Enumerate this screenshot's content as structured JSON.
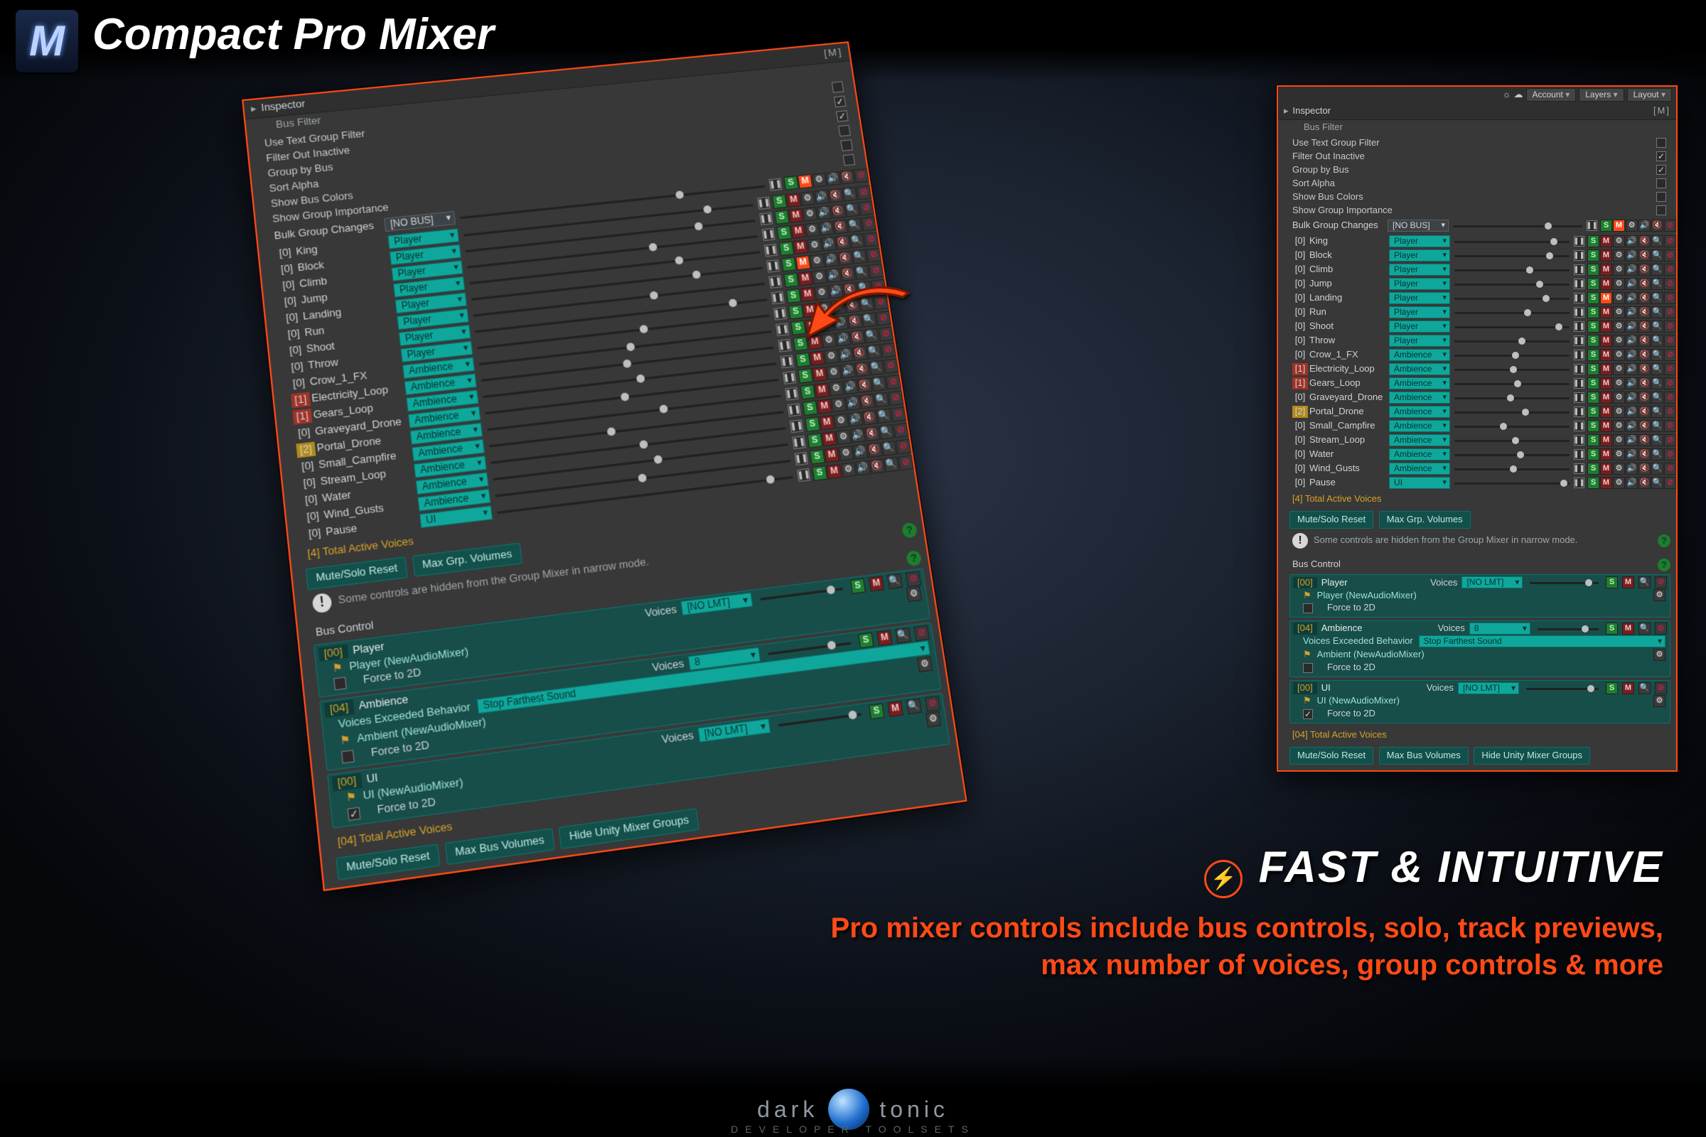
{
  "promo": {
    "title": "Compact Pro Mixer",
    "headline": "FAST & INTUITIVE",
    "subtitle": "Pro mixer controls include bus controls, solo, track previews, max number of voices, group controls & more",
    "brand_left": "dark",
    "brand_right": "tonic",
    "brand_tag": "DEVELOPER   TOOLSETS",
    "logo_letter": "M",
    "bolt": "⚡"
  },
  "inspector": {
    "header": "Inspector",
    "sub": "Bus Filter",
    "corner": "[M]",
    "options": [
      {
        "label": "Use Text Group Filter",
        "checked": false
      },
      {
        "label": "Filter Out Inactive",
        "checked": true
      },
      {
        "label": "Group by Bus",
        "checked": true
      },
      {
        "label": "Sort Alpha",
        "checked": false
      },
      {
        "label": "Show Bus Colors",
        "checked": false
      },
      {
        "label": "Show Group Importance",
        "checked": false
      }
    ],
    "bulk_label": "Bulk Group Changes",
    "bulk_bus": "[NO BUS]",
    "groups": [
      {
        "cnt": "[0]",
        "name": "King",
        "bus": "Player",
        "vol": 0.82
      },
      {
        "cnt": "[0]",
        "name": "Block",
        "bus": "Player",
        "vol": 0.78
      },
      {
        "cnt": "[0]",
        "name": "Climb",
        "bus": "Player",
        "vol": 0.62
      },
      {
        "cnt": "[0]",
        "name": "Jump",
        "bus": "Player",
        "vol": 0.7
      },
      {
        "cnt": "[0]",
        "name": "Landing",
        "bus": "Player",
        "vol": 0.75,
        "alert": true
      },
      {
        "cnt": "[0]",
        "name": "Run",
        "bus": "Player",
        "vol": 0.6
      },
      {
        "cnt": "[0]",
        "name": "Shoot",
        "bus": "Player",
        "vol": 0.86
      },
      {
        "cnt": "[0]",
        "name": "Throw",
        "bus": "Player",
        "vol": 0.55
      },
      {
        "cnt": "[0]",
        "name": "Crow_1_FX",
        "bus": "Ambience",
        "vol": 0.5
      },
      {
        "cnt": "[1]",
        "status": "bad",
        "name": "Electricity_Loop",
        "bus": "Ambience",
        "vol": 0.48
      },
      {
        "cnt": "[1]",
        "status": "bad",
        "name": "Gears_Loop",
        "bus": "Ambience",
        "vol": 0.52
      },
      {
        "cnt": "[0]",
        "name": "Graveyard_Drone",
        "bus": "Ambience",
        "vol": 0.46
      },
      {
        "cnt": "[2]",
        "status": "warn",
        "name": "Portal_Drone",
        "bus": "Ambience",
        "vol": 0.58
      },
      {
        "cnt": "[0]",
        "name": "Small_Campfire",
        "bus": "Ambience",
        "vol": 0.4
      },
      {
        "cnt": "[0]",
        "name": "Stream_Loop",
        "bus": "Ambience",
        "vol": 0.5
      },
      {
        "cnt": "[0]",
        "name": "Water",
        "bus": "Ambience",
        "vol": 0.54
      },
      {
        "cnt": "[0]",
        "name": "Wind_Gusts",
        "bus": "Ambience",
        "vol": 0.48
      },
      {
        "cnt": "[0]",
        "name": "Pause",
        "bus": "UI",
        "vol": 0.9
      }
    ],
    "total_active": "[4] Total Active Voices",
    "mute_reset": "Mute/Solo Reset",
    "max_grp": "Max Grp. Volumes",
    "notice": "Some controls are hidden from the Group Mixer in narrow mode.",
    "bus_section": "Bus Control",
    "voices_label": "Voices",
    "no_limit": "[NO LMT]",
    "buses": [
      {
        "cnt": "[00]",
        "name": "Player",
        "mixer": "Player (NewAudioMixer)",
        "force2d": false,
        "voices": "[NO LMT]",
        "vol": 0.78
      },
      {
        "cnt": "[04]",
        "name": "Ambience",
        "mixer": "Ambient (NewAudioMixer)",
        "force2d": false,
        "voices": "8",
        "vol": 0.7,
        "veb_label": "Voices Exceeded Behavior",
        "veb_value": "Stop Farthest Sound"
      },
      {
        "cnt": "[00]",
        "name": "UI",
        "mixer": "UI (NewAudioMixer)",
        "force2d": true,
        "voices": "[NO LMT]",
        "vol": 0.82
      }
    ],
    "bus_total": "[04] Total Active Voices",
    "bus_pill_1": "Mute/Solo Reset",
    "bus_pill_2": "Max Bus Volumes",
    "bus_pill_3": "Hide Unity Mixer Groups",
    "force2d_label": "Force to 2D",
    "toolbar": {
      "account": "Account",
      "layers": "Layers",
      "layout": "Layout"
    }
  }
}
